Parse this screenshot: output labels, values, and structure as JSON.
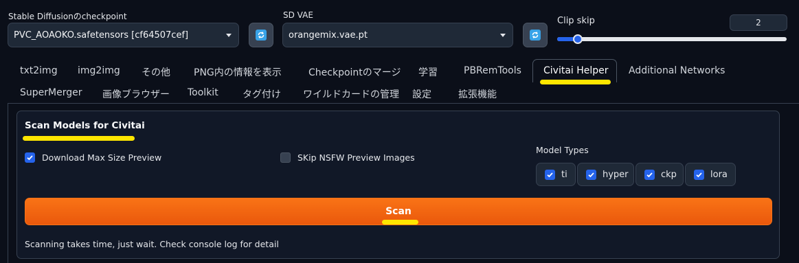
{
  "settings": {
    "checkpoint": {
      "label": "Stable Diffusionのcheckpoint",
      "value": "PVC_AOAOKO.safetensors [cf64507cef]"
    },
    "vae": {
      "label": "SD VAE",
      "value": "orangemix.vae.pt"
    },
    "clip_skip": {
      "label": "Clip skip",
      "value": "2",
      "level_fraction": 0.09
    }
  },
  "tabs": {
    "row1": [
      "txt2img",
      "img2img",
      "その他",
      "PNG内の情報を表示",
      "Checkpointのマージ",
      "学習",
      "PBRemTools",
      "Civitai Helper",
      "Additional Networks"
    ],
    "row2": [
      "SuperMerger",
      "画像ブラウザー",
      "Toolkit",
      "タグ付け",
      "ワイルドカードの管理",
      "設定",
      "拡張機能"
    ],
    "active": "Civitai Helper"
  },
  "scan_panel": {
    "title": "Scan Models for Civitai",
    "download_max_preview": {
      "label": "Download Max Size Preview",
      "checked": true
    },
    "skip_nsfw": {
      "label": "SKip NSFW Preview Images",
      "checked": false
    },
    "model_types": {
      "label": "Model Types",
      "options": [
        {
          "label": "ti",
          "checked": true
        },
        {
          "label": "hyper",
          "checked": true
        },
        {
          "label": "ckp",
          "checked": true
        },
        {
          "label": "lora",
          "checked": true
        }
      ]
    },
    "scan_button": "Scan",
    "note": "Scanning takes time, just wait. Check console log for detail"
  },
  "colors": {
    "background": "#0b0f19",
    "accent_blue": "#2563eb",
    "scan_orange": "#f97316",
    "highlight_yellow": "#ffe600"
  }
}
